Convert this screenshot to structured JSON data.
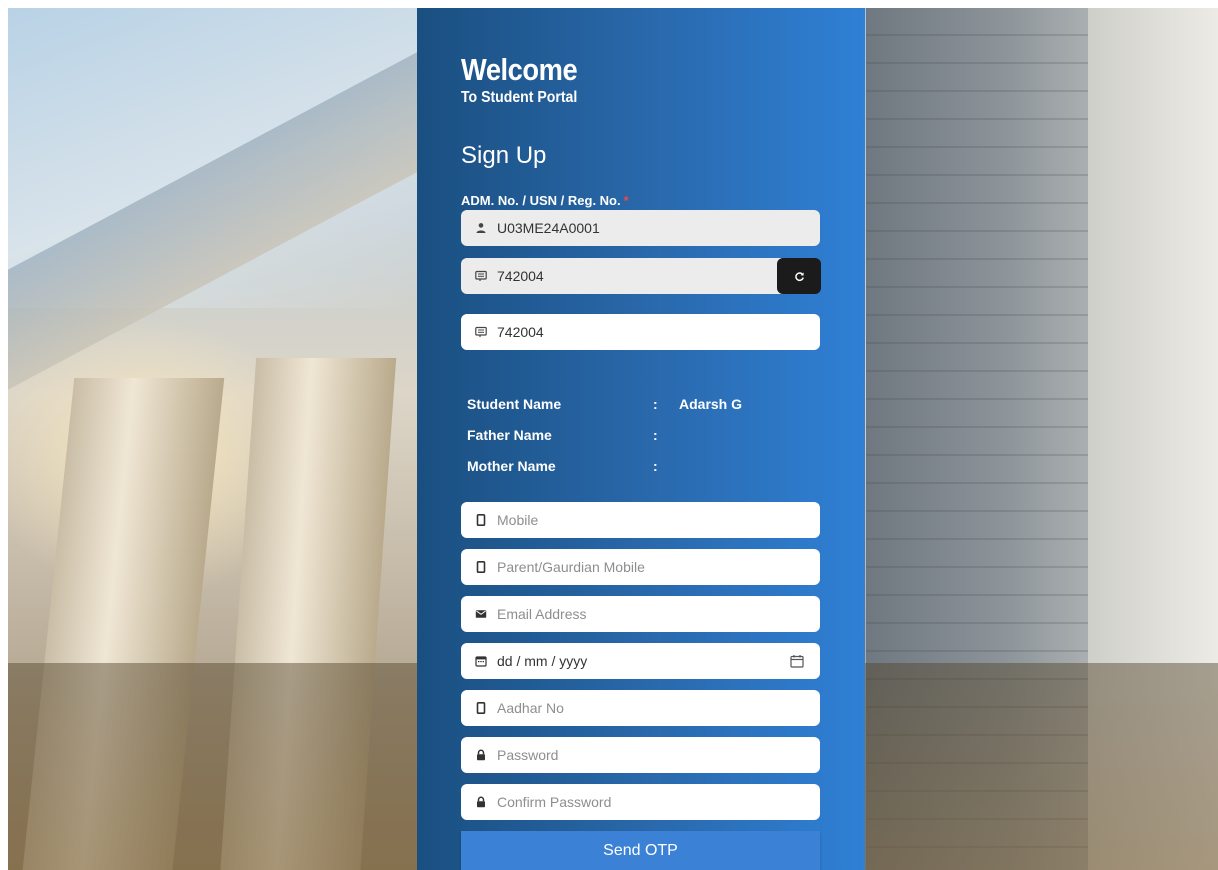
{
  "header": {
    "welcome": "Welcome",
    "subtitle": "To Student Portal",
    "form_title": "Sign Up"
  },
  "registration": {
    "label": "ADM. No. / USN / Reg. No.",
    "required_mark": "*",
    "value": "U03ME24A0001"
  },
  "captcha": {
    "code": "742004",
    "entered_value": "742004",
    "refresh_icon": "refresh-icon"
  },
  "student_info": [
    {
      "label": "Student Name",
      "separator": ":",
      "value": "Adarsh G"
    },
    {
      "label": "Father Name",
      "separator": ":",
      "value": ""
    },
    {
      "label": "Mother Name",
      "separator": ":",
      "value": ""
    }
  ],
  "fields": {
    "mobile": {
      "placeholder": "Mobile",
      "icon": "mobile-icon"
    },
    "parent_mobile": {
      "placeholder": "Parent/Gaurdian Mobile",
      "icon": "mobile-icon"
    },
    "email": {
      "placeholder": "Email Address",
      "icon": "envelope-icon"
    },
    "dob": {
      "placeholder": "dd / mm / yyyy",
      "icon": "calendar-icon"
    },
    "aadhar": {
      "placeholder": "Aadhar No",
      "icon": "mobile-icon"
    },
    "password": {
      "placeholder": "Password",
      "icon": "lock-icon"
    },
    "confirm_password": {
      "placeholder": "Confirm Password",
      "icon": "lock-icon"
    }
  },
  "actions": {
    "send_otp_label": "Send OTP"
  },
  "colors": {
    "panel_start": "#1a4f80",
    "panel_end": "#2f80d6",
    "button": "#3b82d6",
    "required": "#e84a4a"
  }
}
